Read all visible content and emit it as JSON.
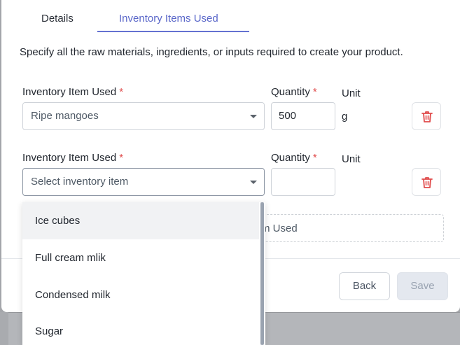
{
  "tabs": [
    {
      "label": "Details",
      "active": false
    },
    {
      "label": "Inventory Items Used",
      "active": true
    }
  ],
  "description": "Specify all the raw materials, ingredients, or inputs required to create your product.",
  "rows": [
    {
      "item_label": "Inventory Item Used",
      "item_value": "Ripe mangoes",
      "quantity_label": "Quantity",
      "quantity_value": "500",
      "unit_label": "Unit",
      "unit_value": "g",
      "required_mark": "*"
    },
    {
      "item_label": "Inventory Item Used",
      "item_placeholder": "Select inventory item",
      "quantity_label": "Quantity",
      "quantity_value": "",
      "unit_label": "Unit",
      "unit_value": "",
      "required_mark": "*"
    }
  ],
  "add_item_partial": "m Used",
  "dropdown_options": [
    "Ice cubes",
    "Full cream mlik",
    "Condensed milk",
    "Sugar"
  ],
  "buttons": {
    "back": "Back",
    "save": "Save"
  },
  "colors": {
    "accent": "#5a67c9",
    "required": "#e04b4b",
    "delete": "#e04b4b",
    "save_disabled_bg": "#e4e8ef"
  },
  "icons": {
    "delete": "trash-icon",
    "dropdown": "chevron-down-icon"
  }
}
